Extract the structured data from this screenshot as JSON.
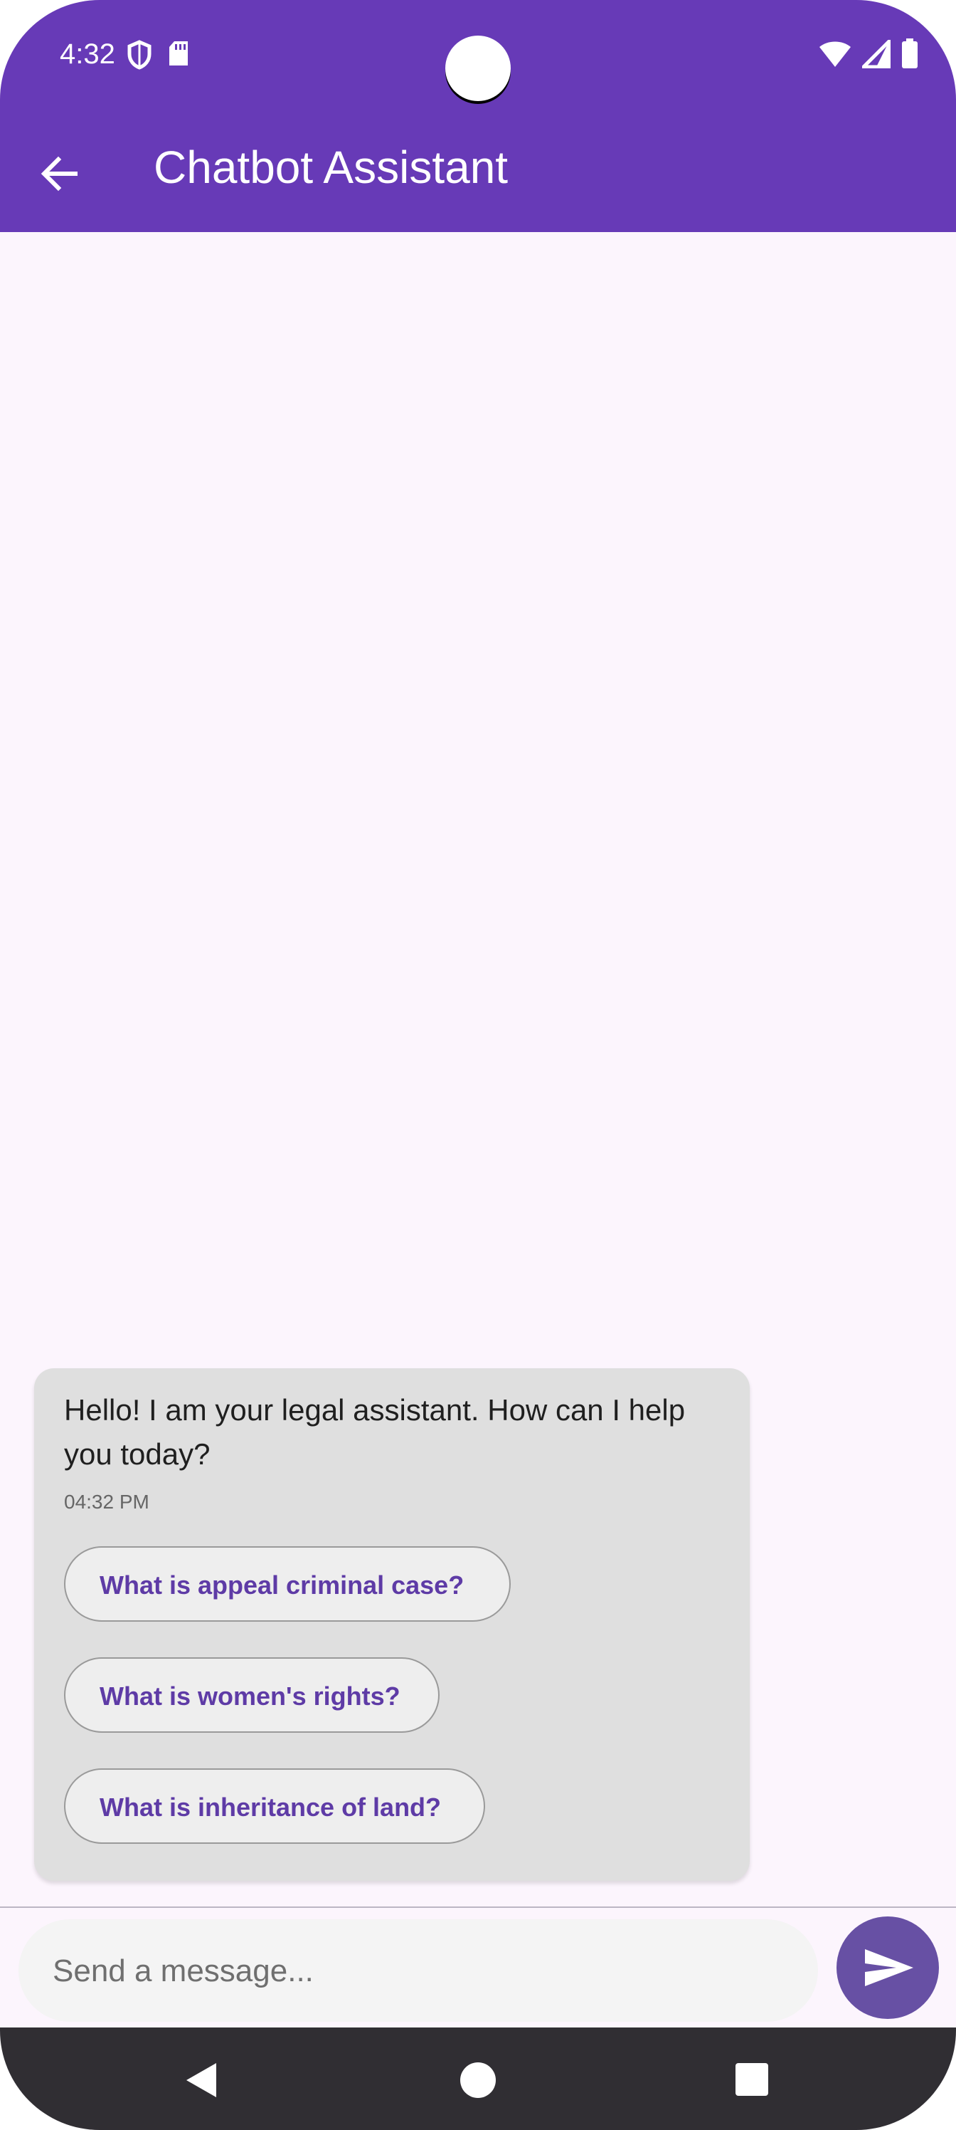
{
  "status_bar": {
    "time": "4:32",
    "left_icons": [
      "shield-icon",
      "sd-card-icon"
    ],
    "right_icons": [
      "wifi-icon",
      "signal-icon",
      "battery-icon"
    ]
  },
  "app_bar": {
    "title": "Chatbot Assistant",
    "back_icon": "arrow-back-icon",
    "color": "#673ab7"
  },
  "messages": [
    {
      "sender": "bot",
      "text": "Hello! I am your legal assistant. How can I help you today?",
      "time": "04:32 PM",
      "suggestions": [
        "What is appeal criminal case?",
        "What is women's rights?",
        "What is inheritance of land?"
      ]
    }
  ],
  "composer": {
    "placeholder": "Send a message...",
    "value": "",
    "send_icon": "send-icon",
    "send_color": "#6750a4"
  },
  "nav_bar": {
    "buttons": [
      "back-triangle-icon",
      "home-circle-icon",
      "recents-square-icon"
    ]
  }
}
